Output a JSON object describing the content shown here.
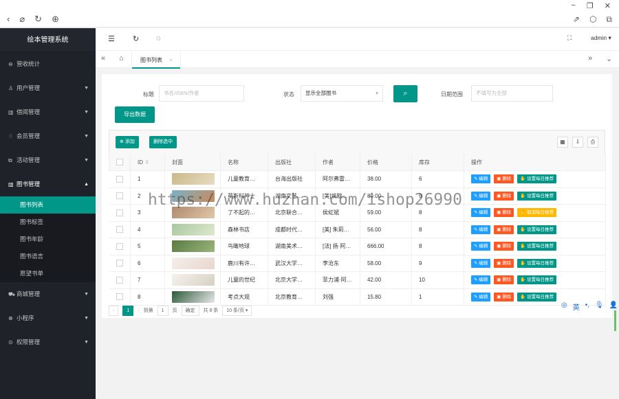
{
  "app": {
    "title": "绘本管理系统",
    "user": "admin"
  },
  "menu": [
    {
      "label": "营收统计",
      "icon": "chart-icon",
      "arrow": false
    },
    {
      "label": "用户管理",
      "icon": "user-icon",
      "arrow": true
    },
    {
      "label": "借阅管理",
      "icon": "book-icon",
      "arrow": true
    },
    {
      "label": "会员管理",
      "icon": "vip-icon",
      "arrow": true
    },
    {
      "label": "活动管理",
      "icon": "activity-icon",
      "arrow": true
    },
    {
      "label": "图书管理",
      "icon": "library-icon",
      "arrow": true,
      "open": true
    }
  ],
  "submenu": [
    "图书列表",
    "图书标签",
    "图书年龄",
    "图书语言",
    "愿望书单"
  ],
  "menu2": [
    {
      "label": "商城管理",
      "icon": "cart-icon"
    },
    {
      "label": "小程序",
      "icon": "miniapp-icon"
    },
    {
      "label": "权限管理",
      "icon": "lock-icon"
    }
  ],
  "tab": {
    "label": "图书列表",
    "close": "×"
  },
  "filter": {
    "title_label": "标题",
    "title_placeholder": "书名/ISBN/作者",
    "status_label": "状态",
    "status_value": "全部图书",
    "status_prefix": "显示",
    "date_label": "日期范围",
    "date_placeholder": "不填写为全部",
    "export": "导出数据"
  },
  "toolbar": {
    "add": "添加",
    "del": "删除选中"
  },
  "table": {
    "headers": [
      "ID",
      "封面",
      "名称",
      "出版社",
      "作者",
      "价格",
      "库存",
      "操作"
    ],
    "rows": [
      {
        "id": "1",
        "name": "儿童教育…",
        "pub": "台海出版社",
        "author": "阿尔弗雷…",
        "price": "38.00",
        "stock": "6",
        "rec": "设置每日推荐",
        "recType": "r",
        "cover": [
          "#c9b98a",
          "#e8dcc0"
        ]
      },
      {
        "id": "2",
        "name": "莫斯科神士",
        "pub": "湖南文艺…",
        "author": "[美]埃默…",
        "price": "89.00",
        "stock": "9",
        "rec": "设置每日推荐",
        "recType": "r",
        "cover": [
          "#7ab2c9",
          "#c98a5a"
        ]
      },
      {
        "id": "3",
        "name": "了不起的…",
        "pub": "北京联合…",
        "author": "侯虹斌",
        "price": "59.00",
        "stock": "8",
        "rec": "取消每日推荐",
        "recType": "c",
        "cover": [
          "#b0896e",
          "#e0c8a8"
        ]
      },
      {
        "id": "4",
        "name": "森林书店",
        "pub": "成都时代…",
        "author": "[美] 朱莉…",
        "price": "56.00",
        "stock": "8",
        "rec": "设置每日推荐",
        "recType": "r",
        "cover": [
          "#a8c8a0",
          "#dfe8cf"
        ]
      },
      {
        "id": "5",
        "name": "鸟瞰地球",
        "pub": "湖南美术…",
        "author": "[法] 扬·阿…",
        "price": "666.00",
        "stock": "8",
        "rec": "设置每日推荐",
        "recType": "r",
        "cover": [
          "#5a7a45",
          "#9bb57a"
        ]
      },
      {
        "id": "6",
        "name": "鹿川有许…",
        "pub": "武汉大学…",
        "author": "李沧东",
        "price": "58.00",
        "stock": "9",
        "rec": "设置每日推荐",
        "recType": "r",
        "cover": [
          "#f3efea",
          "#e9d6cf"
        ]
      },
      {
        "id": "7",
        "name": "儿童的世纪",
        "pub": "北京大学…",
        "author": "菲力浦·阿…",
        "price": "42.00",
        "stock": "10",
        "rec": "设置每日推荐",
        "recType": "r",
        "cover": [
          "#f5f2ec",
          "#d8d0c4"
        ]
      },
      {
        "id": "8",
        "name": "考点大观",
        "pub": "北京教育…",
        "author": "刘强",
        "price": "15.80",
        "stock": "1",
        "rec": "设置每日推荐",
        "recType": "r",
        "cover": [
          "#2e5a3a",
          "#e8e8e8"
        ]
      }
    ],
    "edit": "编辑",
    "del": "删除"
  },
  "pager": {
    "page": "1",
    "goto": "到第",
    "page_input": "1",
    "page_unit": "页",
    "confirm": "确定",
    "total": "共 8 条",
    "size": "10 条/页"
  },
  "watermark": "https://www.huzhan.com/ishop26990",
  "ime": "英"
}
